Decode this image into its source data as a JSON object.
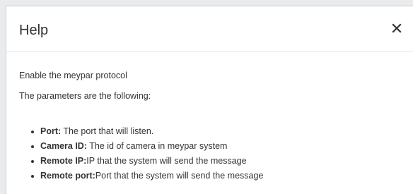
{
  "dialog": {
    "title": "Help",
    "close_icon": "close-icon"
  },
  "content": {
    "intro": "Enable the meypar protocol",
    "subtitle": "The parameters are the following:",
    "params": [
      {
        "label": "Port:",
        "text": " The port that will listen."
      },
      {
        "label": "Camera ID:",
        "text": " The id of camera in meypar system"
      },
      {
        "label": "Remote IP:",
        "text": "IP that the system will send the message"
      },
      {
        "label": "Remote port:",
        "text": "Port that the system will send the message"
      }
    ]
  },
  "colors": {
    "text": "#333333",
    "border": "#c9cdd1",
    "backdrop": "#e9ebed"
  }
}
